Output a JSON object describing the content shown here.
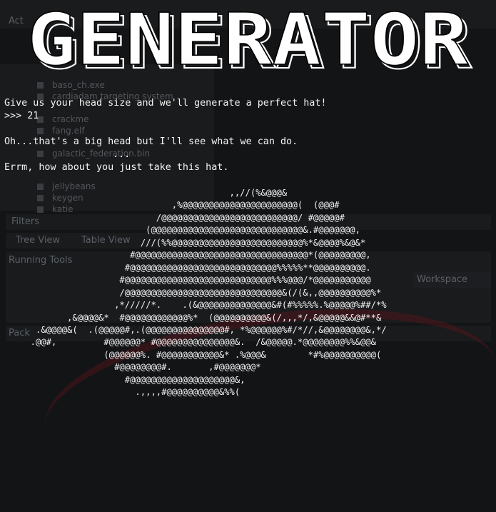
{
  "background": {
    "labels": [
      "Act",
      "Filters",
      "Tree View",
      "Table View",
      "Running Tools",
      "Workspace",
      "Pack"
    ],
    "file_rows": [
      "baso_ch.exe",
      "cardiadam targeting system",
      "crackme",
      "fang.elf",
      "galactic_federation.bin",
      "jellybeans",
      "keygen",
      "katie"
    ]
  },
  "banner": {
    "title": "GENERATOR"
  },
  "terminal": {
    "prompt_intro": "Give us your head size and we'll generate a perfect hat!",
    "prompt_input": ">>> 21",
    "response_1": "Oh...that's a big head but I'll see what we can do.",
    "response_2": "...",
    "response_3": "Errm, how about you just take this hat."
  },
  "hat_art": [
    "                                           ,,//(%&@@@&",
    "                                ,%@@@@@@@@@@@@@@@@@@@@@@(  (@@@#",
    "                             /@@@@@@@@@@@@@@@@@@@@@@@@@@/ #@@@@@#",
    "                           (@@@@@@@@@@@@@@@@@@@@@@@@@@@@@&.#@@@@@@@,",
    "                          ///(%%@@@@@@@@@@@@@@@@@@@@@@@@@%*&@@@@%&@&*",
    "                        #@@@@@@@@@@@@@@@@@@@@@@@@@@@@@@@@@*(@@@@@@@@@,",
    "                       #@@@@@@@@@@@@@@@@@@@@@@@@@@@@%%%%%**@@@@@@@@@@.",
    "                      #@@@@@@@@@@@@@@@@@@@@@@@@@@@@%%%@@@/*@@@@@@@@@@@",
    "                      /@@@@@@@@@@@@@@@@@@@@@@@@@@@@@@&(/(&,,@@@@@@@@@@%*",
    "                     ,*/////*.    .(&@@@@@@@@@@@@@@&#(#%%%%%.%@@@@@%##/*%",
    "            ,&@@@@&*  #@@@@@@@@@@@@%*  (@@@@@@@@@@&(/,,,*/,&@@@@@&&@#**&",
    "      .&@@@@&(  .(@@@@@#,.(@@@@@@@@@@@@@@@#, *%@@@@@@%#/*//,&@@@@@@@@&,*/",
    "     .@@#,         #@@@@@@* #@@@@@@@@@@@@@@@&.  /&@@@@@.*@@@@@@@@%%&@@&",
    "                   (@@@@@@%. #@@@@@@@@@@@&* .%@@@&        *#%@@@@@@@@@@(",
    "                     #@@@@@@@@#.       ,#@@@@@@@*",
    "                       #@@@@@@@@@@@@@@@@@@@@&,",
    "                         .,,,,#@@@@@@@@@@&%%("
  ]
}
